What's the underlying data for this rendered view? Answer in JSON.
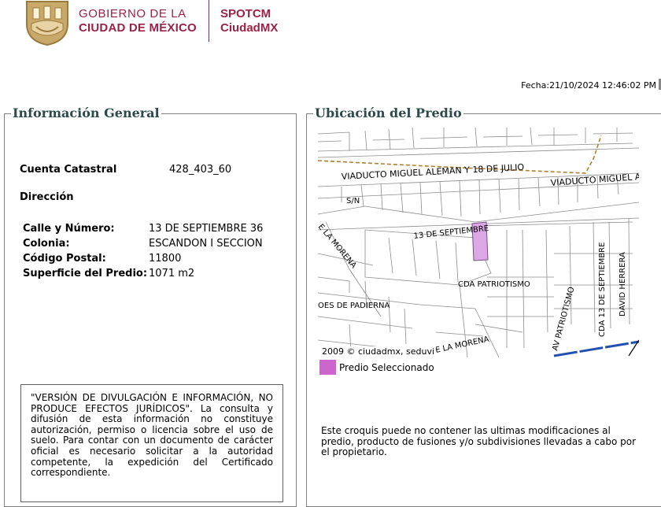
{
  "header": {
    "gov_line1": "GOBIERNO DE LA",
    "gov_line2": "CIUDAD DE MÉXICO",
    "app_line1": "SPOTCM",
    "app_line2": "CiudadMX",
    "brand_color": "#9b2247",
    "logo_icon": "cdmx-coat-of-arms-icon"
  },
  "fecha": "Fecha:21/10/2024 12:46:02 PM",
  "info": {
    "legend": "Información General",
    "cuenta_label": "Cuenta Catastral",
    "cuenta_value": "428_403_60",
    "direccion_label": "Dirección",
    "calle_label": "Calle y Número:",
    "calle_value": "13 DE SEPTIEMBRE 36",
    "colonia_label": "Colonia:",
    "colonia_value": "ESCANDON I SECCION",
    "cp_label": "Código Postal:",
    "cp_value": "11800",
    "superficie_label": "Superficie del Predio:",
    "superficie_value": "1071 m2",
    "disclaimer": "\"VERSIÓN DE DIVULGACIÓN E INFORMACIÓN, NO PRODUCE EFECTOS JURÍDICOS\". La consulta y difusión de esta información no constituye autorización, permiso o licencia sobre el uso de suelo. Para contar con un documento de carácter oficial es necesario solicitar a la autoridad competente, la expedición del Certificado correspondiente."
  },
  "ubicacion": {
    "legend": "Ubicación del Predio",
    "map_credit": "2009 © ciudadmx, seduvi",
    "legend_label": "Predio Seleccionado",
    "legend_color": "#cc66cc",
    "note": "Este croquis puede no contener las ultimas modificaciones al predio, producto de fusiones y/o subdivisiones llevadas a cabo por el propietario.",
    "streets": {
      "viaducto1": "VIADUCTO MIGUEL ALEMAN Y 18 DE JULIO",
      "viaducto2": "VIADUCTO MIGUEL A",
      "sn": "S/N",
      "septiembre": "13 DE SEPTIEMBRE",
      "la_morena1": "E LA MORENA",
      "cda_patriotismo": "CDA PATRIOTISMO",
      "padierna": "OES DE PADIERNA",
      "av_patriotismo": "AV PATRIOTISMO",
      "cda_13": "CDA 13 DE SEPTIEMBRE",
      "david": "DAVID HERRERA",
      "la_morena2": "E LA MORENA"
    }
  }
}
